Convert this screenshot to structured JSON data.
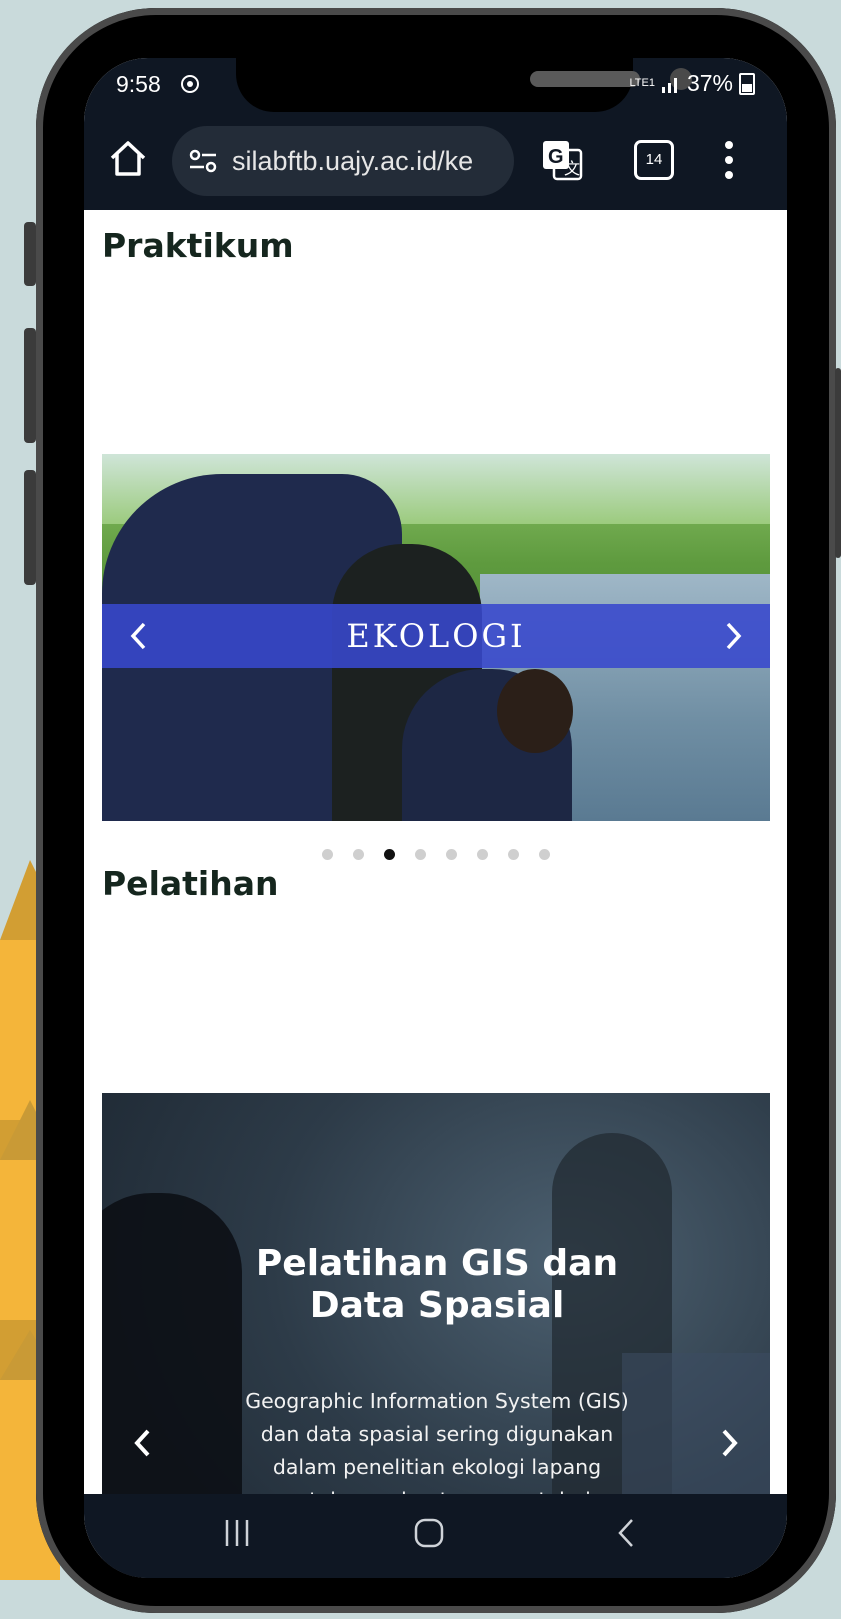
{
  "status_bar": {
    "time": "9:58",
    "battery_percent": "37%",
    "network": "LTE1"
  },
  "browser": {
    "url": "silabftb.uajy.ac.id/ke",
    "tab_count": "14"
  },
  "sections": {
    "praktikum": {
      "title": "Praktikum",
      "slide_label": "EKOLOGI",
      "slide_count": 8,
      "active_slide_index": 2
    },
    "pelatihan": {
      "title": "Pelatihan",
      "slide_heading": "Pelatihan GIS dan Data Spasial",
      "slide_description": "Geographic Information System (GIS) dan data spasial sering digunakan dalam penelitian ekologi lapang untuk membantu mengetahui informasi biodiversitas yang ada di suatu kawasan dan membantu saat sampling"
    }
  },
  "colors": {
    "browser_bar": "#0f1723",
    "carousel_band": "#3848cd",
    "heading_text": "#15261e",
    "background": "#c9dadb",
    "accent_yellow": "#f4b53a"
  },
  "icons": [
    "home-icon",
    "site-settings-icon",
    "translate-icon",
    "tabs-icon",
    "more-menu-icon",
    "chevron-left-icon",
    "chevron-right-icon",
    "recent-apps-icon",
    "home-nav-icon",
    "back-nav-icon"
  ]
}
